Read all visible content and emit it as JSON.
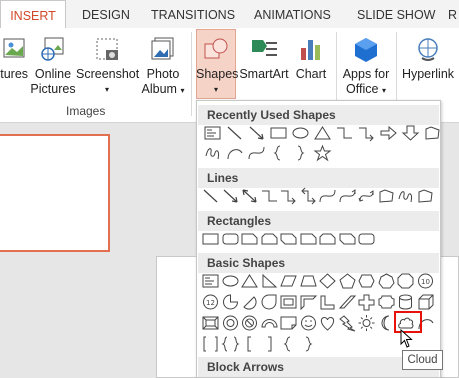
{
  "tabs": [
    "INSERT",
    "DESIGN",
    "TRANSITIONS",
    "ANIMATIONS",
    "SLIDE SHOW",
    "R"
  ],
  "ribbon": {
    "pictures": "ctures",
    "online_pictures_1": "Online",
    "online_pictures_2": "Pictures",
    "screenshot": "Screenshot",
    "photo_album_1": "Photo",
    "photo_album_2": "Album",
    "images_group": "Images",
    "shapes": "Shapes",
    "smartart": "SmartArt",
    "chart": "Chart",
    "apps_1": "Apps for",
    "apps_2": "Office",
    "hyperlink": "Hyperlink"
  },
  "gallery": {
    "recent": "Recently Used Shapes",
    "lines": "Lines",
    "rectangles": "Rectangles",
    "basic": "Basic Shapes",
    "block_arrows": "Block Arrows",
    "tooltip": "Cloud"
  },
  "colors": {
    "accent": "#d24726",
    "highlight": "#e8120c",
    "shapes_active": "#f6d3c7"
  }
}
